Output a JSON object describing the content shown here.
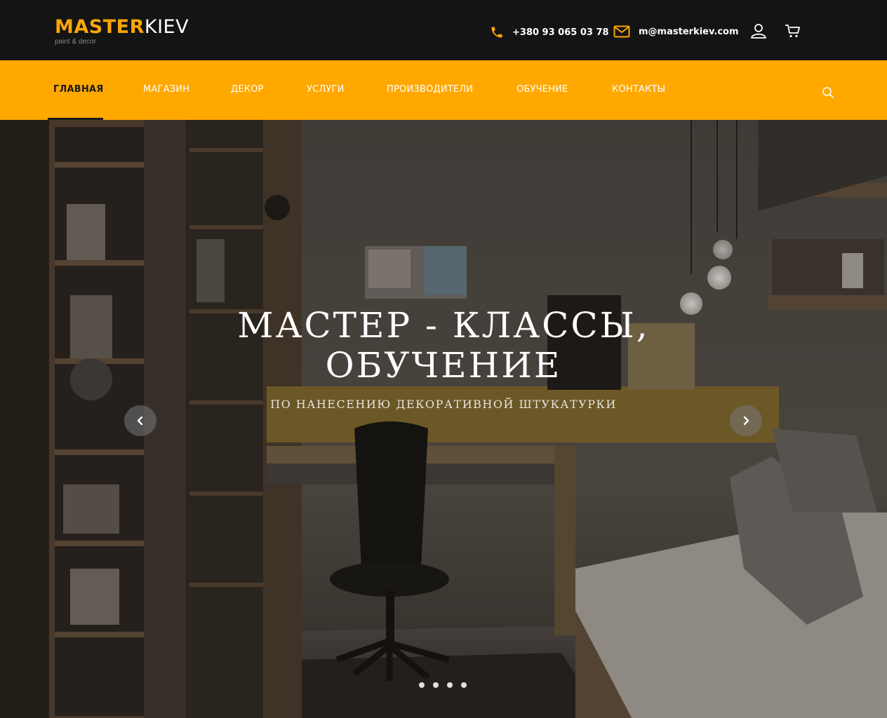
{
  "brand": {
    "name_part1": "MASTER",
    "name_part2": "KIEV",
    "tagline": "paint & decor",
    "accent_color": "#ffa800"
  },
  "contacts": {
    "phone": "+380 93 065 03 78",
    "email": "m@masterkiev.com",
    "phone_icon": "phone-icon",
    "email_icon": "envelope-icon"
  },
  "header_icons": [
    "user-icon",
    "cart-icon"
  ],
  "nav": {
    "items": [
      {
        "label": "ГЛАВНАЯ",
        "active": true
      },
      {
        "label": "МАГАЗИН",
        "active": false
      },
      {
        "label": "ДЕКОР",
        "active": false
      },
      {
        "label": "УСЛУГИ",
        "active": false
      },
      {
        "label": "ПРОИЗВОДИТЕЛИ",
        "active": false
      },
      {
        "label": "ОБУЧЕНИЕ",
        "active": false
      },
      {
        "label": "КОНТАКТЫ",
        "active": false
      }
    ],
    "search_icon": "search-icon"
  },
  "hero": {
    "title_line1": "МАСТЕР - КЛАССЫ,",
    "title_line2": "ОБУЧЕНИЕ",
    "subtitle": "ПО НАНЕСЕНИЮ ДЕКОРАТИВНОЙ ШТУКАТУРКИ",
    "slide_count": 4,
    "active_slide": 1
  }
}
